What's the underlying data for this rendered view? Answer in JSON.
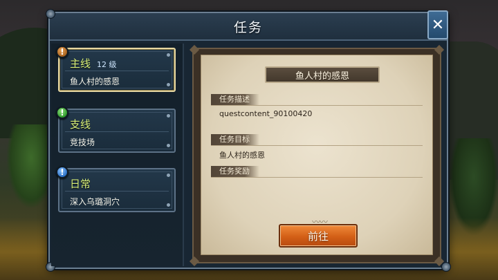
{
  "window": {
    "title": "任务",
    "close_label": "✕"
  },
  "quest_list": [
    {
      "category": "主线",
      "level": "12 级",
      "name": "鱼人村的感恩",
      "badge": "!",
      "badge_color": "#c07a2a",
      "selected": true
    },
    {
      "category": "支线",
      "level": "",
      "name": "竞技场",
      "badge": "!",
      "badge_color": "#3aa63a",
      "selected": false
    },
    {
      "category": "日常",
      "level": "",
      "name": "深入乌璐洞穴",
      "badge": "!",
      "badge_color": "#3b7fd0",
      "selected": false
    }
  ],
  "detail": {
    "quest_title": "鱼人村的感恩",
    "description_label": "任务描述",
    "description_text": "questcontent_90100420",
    "objective_label": "任务目标",
    "objective_text": "鱼人村的感恩",
    "reward_label": "任务奖励",
    "go_button": "前往"
  },
  "colors": {
    "accent_gold": "#e6d7a2",
    "category_text": "#d8f07a",
    "go_button": "#d35f16"
  }
}
